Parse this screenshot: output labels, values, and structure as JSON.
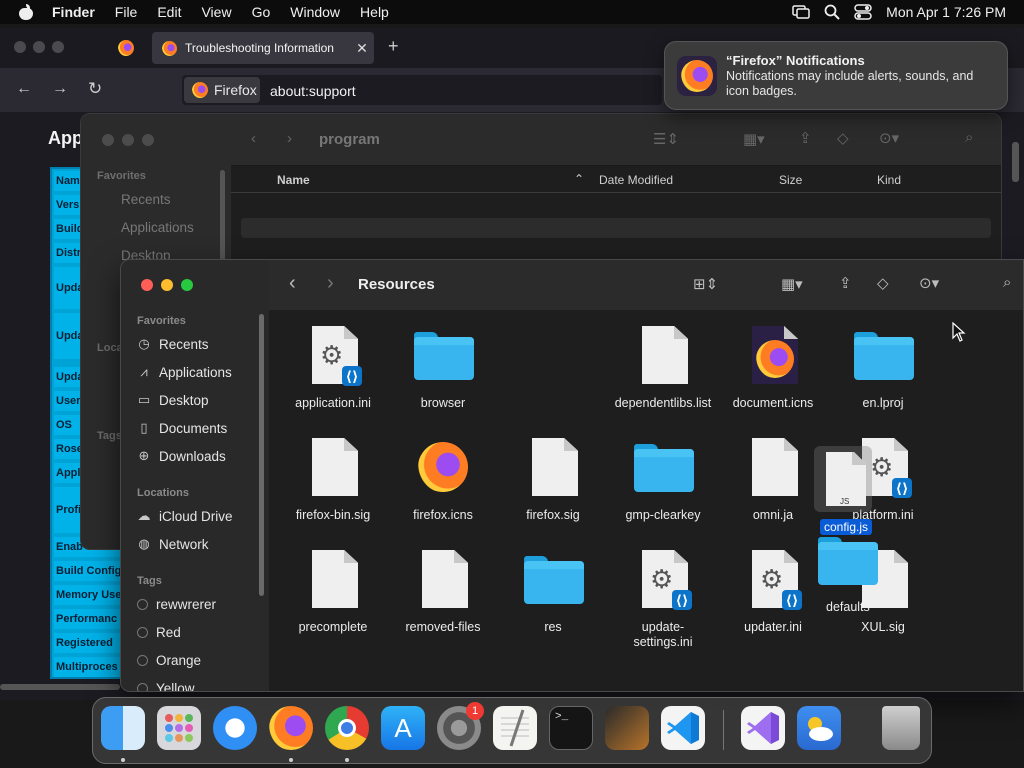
{
  "menubar": {
    "app": "Finder",
    "items": [
      "File",
      "Edit",
      "View",
      "Go",
      "Window",
      "Help"
    ],
    "clock": "Mon Apr 1  7:26 PM"
  },
  "firefox": {
    "tab_title": "Troubleshooting Information",
    "identity": "Firefox",
    "url": "about:support",
    "page_title": "App",
    "table_rows": [
      "Name",
      "Vers",
      "Build",
      "Distr",
      "Upda",
      "Upda",
      "Upda",
      "User",
      "OS",
      "Rose",
      "Appl",
      "Profi",
      "Enab",
      "Build Config",
      "Memory Use",
      "Performanc",
      "Registered",
      "Multiproces"
    ]
  },
  "notification": {
    "title": "“Firefox” Notifications",
    "body": "Notifications may include alerts, sounds, and icon badges."
  },
  "finder_back": {
    "folder": "program",
    "sidebar": {
      "favorites_header": "Favorites",
      "items": [
        "Recents",
        "Applications",
        "Desktop"
      ],
      "locations_header": "Locat",
      "tags_header": "Tags"
    },
    "columns": {
      "name": "Name",
      "date": "Date Modified",
      "size": "Size",
      "kind": "Kind"
    }
  },
  "finder_front": {
    "folder": "Resources",
    "sidebar": {
      "favorites_header": "Favorites",
      "favorites": [
        {
          "label": "Recents",
          "icon": "clock-icon"
        },
        {
          "label": "Applications",
          "icon": "applications-icon"
        },
        {
          "label": "Desktop",
          "icon": "desktop-icon"
        },
        {
          "label": "Documents",
          "icon": "document-icon"
        },
        {
          "label": "Downloads",
          "icon": "downloads-icon"
        }
      ],
      "locations_header": "Locations",
      "locations": [
        {
          "label": "iCloud Drive",
          "icon": "cloud-icon"
        },
        {
          "label": "Network",
          "icon": "globe-icon"
        }
      ],
      "tags_header": "Tags",
      "tags": [
        {
          "label": "rewwrerer",
          "color": "#1e1e1e"
        },
        {
          "label": "Red",
          "color": "#1e1e1e"
        },
        {
          "label": "Orange",
          "color": "#1e1e1e"
        },
        {
          "label": "Yellow",
          "color": "#1e1e1e"
        }
      ]
    },
    "files": [
      {
        "name": "application.ini",
        "type": "ini"
      },
      {
        "name": "browser",
        "type": "folder"
      },
      {
        "name": "dependentlibs.list",
        "type": "doc"
      },
      {
        "name": "document.icns",
        "type": "icns"
      },
      {
        "name": "en.lproj",
        "type": "folder"
      },
      {
        "name": "firefox-bin.sig",
        "type": "doc"
      },
      {
        "name": "firefox.icns",
        "type": "icns"
      },
      {
        "name": "firefox.sig",
        "type": "doc"
      },
      {
        "name": "gmp-clearkey",
        "type": "folder"
      },
      {
        "name": "omni.ja",
        "type": "doc"
      },
      {
        "name": "platform.ini",
        "type": "ini"
      },
      {
        "name": "precomplete",
        "type": "doc"
      },
      {
        "name": "removed-files",
        "type": "doc"
      },
      {
        "name": "res",
        "type": "folder"
      },
      {
        "name": "update-settings.ini",
        "type": "ini"
      },
      {
        "name": "updater.ini",
        "type": "ini"
      },
      {
        "name": "XUL.sig",
        "type": "doc"
      }
    ],
    "drag": {
      "name": "config.js",
      "badge": "JS",
      "folder": "defaults"
    }
  },
  "dock": {
    "items": [
      "finder-icon",
      "launchpad-icon",
      "safari-icon",
      "firefox-icon",
      "chrome-icon",
      "app-store-icon",
      "system-settings-icon",
      "textedit-icon",
      "terminal-icon",
      "instruments-icon",
      "vscode-icon",
      "visual-studio-icon",
      "weather-icon",
      "trash-icon"
    ],
    "settings_badge": "1"
  },
  "colors": {
    "accent": "#0a84ff",
    "table_cyan": "#00b2e8"
  }
}
